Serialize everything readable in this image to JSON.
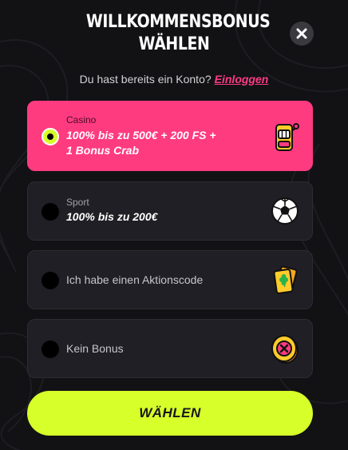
{
  "header": {
    "title_line1": "WILLKOMMENSBONUS",
    "title_line2": "WÄHLEN",
    "close_icon": "close-icon"
  },
  "login": {
    "text": "Du hast bereits ein Konto?",
    "link": "Einloggen"
  },
  "options": [
    {
      "category": "Casino",
      "desc_line1": "100% bis zu 500€ + 200 FS +",
      "desc_line2": "1 Bonus Crab",
      "icon": "slot-machine-icon",
      "selected": true
    },
    {
      "category": "Sport",
      "desc_line1": "100% bis zu 200€",
      "icon": "soccer-ball-icon",
      "selected": false
    },
    {
      "label": "Ich habe einen Aktionscode",
      "icon": "promo-ticket-icon",
      "selected": false
    },
    {
      "label": "Kein Bonus",
      "icon": "no-bonus-coin-icon",
      "selected": false
    }
  ],
  "cta": {
    "label": "WÄHLEN"
  },
  "colors": {
    "background": "#121215",
    "accent_pink": "#ff3b80",
    "accent_lime": "#d7ff2a",
    "card": "#1f1f25"
  }
}
